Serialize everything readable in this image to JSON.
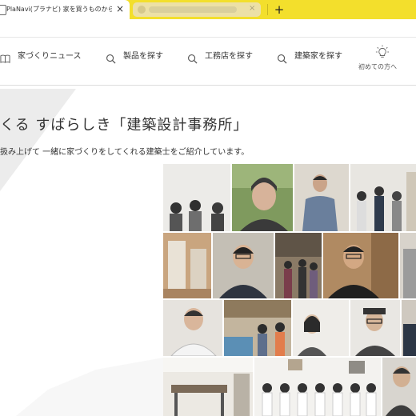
{
  "browser": {
    "active_tab_title": "PlaNavi(プラナビ) 家を買うものから創",
    "tab_close_glyph": "×",
    "new_tab_glyph": "+"
  },
  "nav": {
    "items": [
      {
        "label": "家づくりニュース",
        "icon": "book-icon"
      },
      {
        "label": "製品を探す",
        "icon": "search-icon"
      },
      {
        "label": "工務店を探す",
        "icon": "search-icon"
      },
      {
        "label": "建築家を探す",
        "icon": "search-icon"
      }
    ],
    "help_label": "初めての方へ",
    "help_icon": "lightbulb-icon"
  },
  "hero": {
    "headline": "くる すばらしき「建築設計事務所」",
    "subline": "扱み上げて 一緒に家づくりをしてくれる建築士をご紹介しています。"
  },
  "colors": {
    "tab_strip": "#f3df2c",
    "accent_text": "#333333"
  }
}
